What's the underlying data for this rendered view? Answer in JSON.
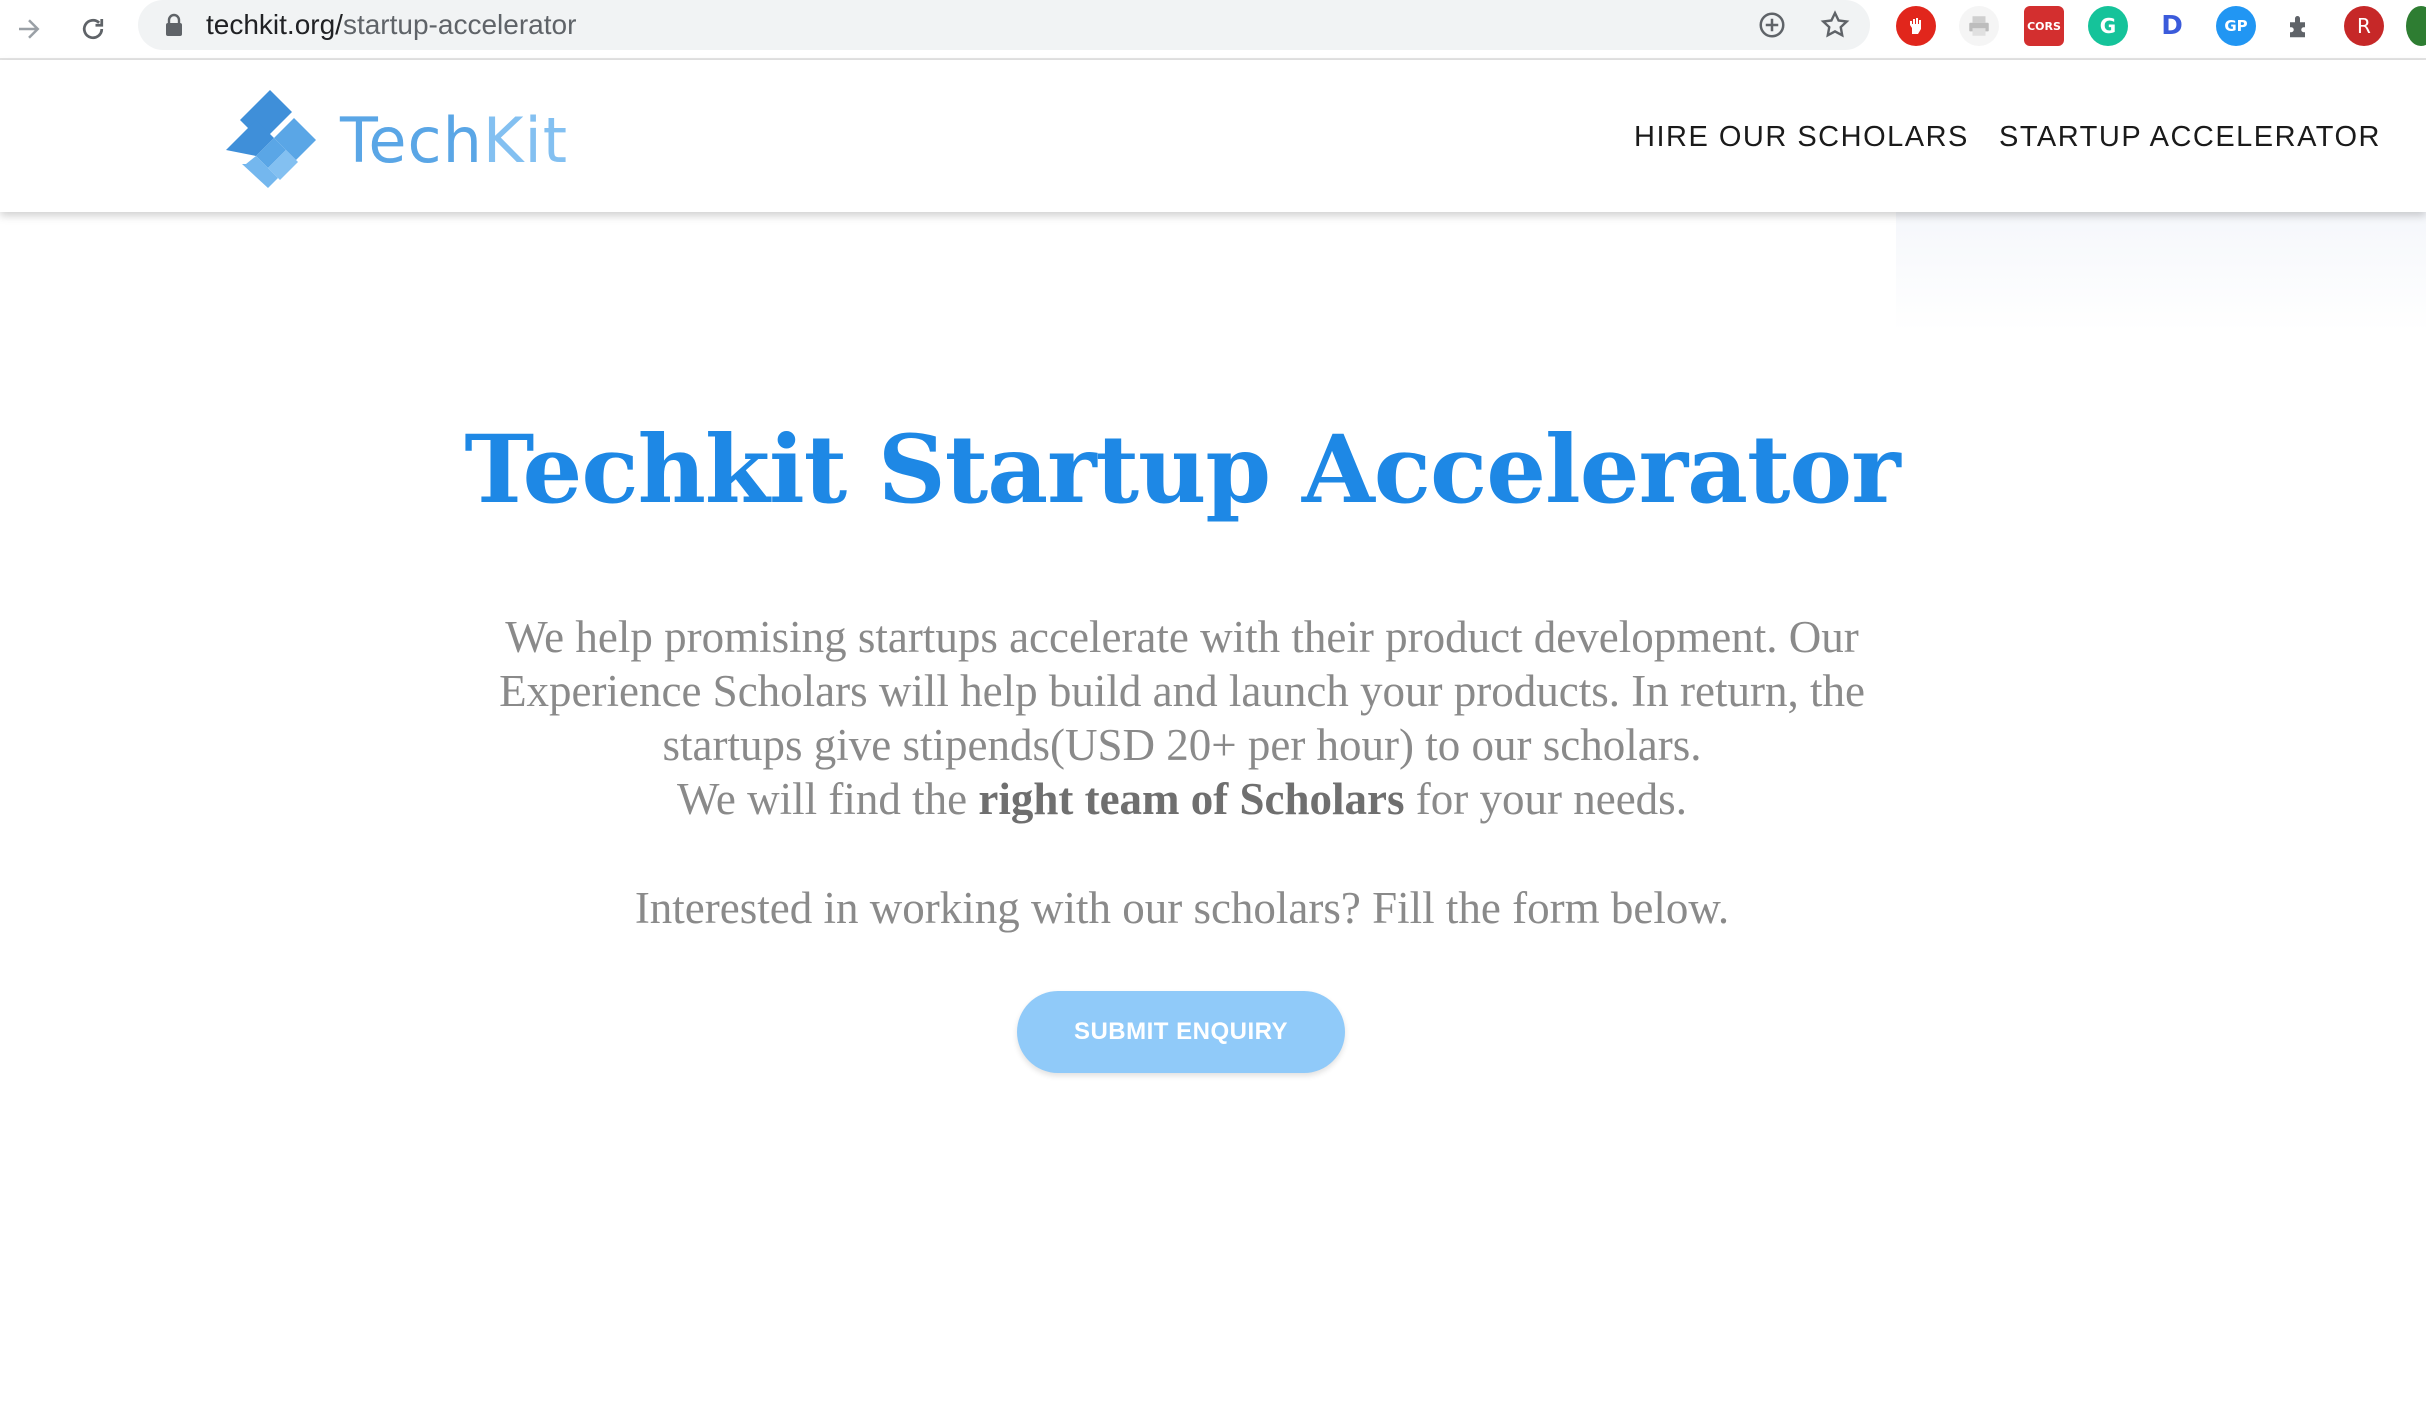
{
  "browser": {
    "url_host": "techkit.org/",
    "url_path": "startup-accelerator",
    "extensions": [
      {
        "name": "adblock",
        "label": "",
        "color": "#e1261c"
      },
      {
        "name": "printer",
        "label": "",
        "color": "#d9d9d9"
      },
      {
        "name": "cors",
        "label": "CORS",
        "color": "#d32f2f"
      },
      {
        "name": "grammarly",
        "label": "G",
        "color": "#15c39a"
      },
      {
        "name": "dashlane",
        "label": "D",
        "color": "#3b5bdb"
      },
      {
        "name": "gp",
        "label": "GP",
        "color": "#2196f3"
      },
      {
        "name": "puzzle",
        "label": "",
        "color": "#5f6368"
      },
      {
        "name": "profile",
        "label": "R",
        "color": "#c62828"
      }
    ]
  },
  "header": {
    "logo_tech": "Tech",
    "logo_kit": "Kit",
    "nav": [
      "HIRE OUR SCHOLARS",
      "STARTUP ACCELERATOR"
    ]
  },
  "hero": {
    "title": "Techkit Startup Accelerator",
    "line1": "We help promising startups accelerate with their product development. Our",
    "line2": "Experience Scholars will help build and launch your products. In return, the",
    "line3": "startups give stipends(USD 20+ per hour) to our scholars.",
    "line4_pre": "We will find the ",
    "line4_bold": "right team of Scholars",
    "line4_post": " for your needs.",
    "cta_text": "Interested in working with our scholars? Fill the form below.",
    "button_label": "SUBMIT ENQUIRY"
  },
  "colors": {
    "accent": "#1e88e5",
    "button": "#90caf9",
    "body_text": "#8a8a8a"
  }
}
